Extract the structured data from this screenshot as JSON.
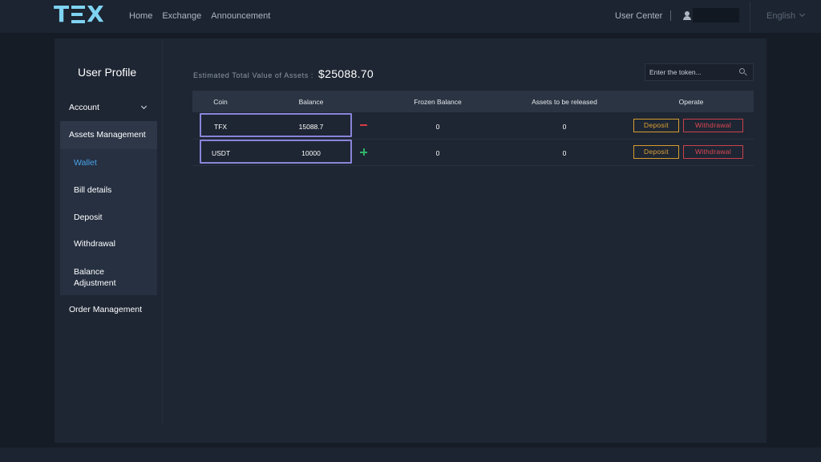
{
  "header": {
    "logo_text": "TEX",
    "nav": [
      "Home",
      "Exchange",
      "Announcement"
    ],
    "user_center": "User Center",
    "language": "English",
    "icons": [
      "user-icon",
      "chevron-down-icon"
    ]
  },
  "sidebar": {
    "title": "User Profile",
    "account": "Account",
    "assets_management": "Assets Management",
    "sub_items": [
      "Wallet",
      "Bill details",
      "Deposit",
      "Withdrawal",
      "Balance Adjustment"
    ],
    "active_item": "Wallet",
    "order_management": "Order Management"
  },
  "summary": {
    "label": "Estimated Total Value of Assets :",
    "value": "$25088.70"
  },
  "search": {
    "placeholder": "Enter the token..."
  },
  "table": {
    "columns": [
      "Coin",
      "Balance",
      "Frozen Balance",
      "Assets to be released",
      "Operate"
    ],
    "rows": [
      {
        "coin": "TFX",
        "balance": "15088.7",
        "frozen": "0",
        "to_release": "0",
        "adjust_icon": "minus-icon"
      },
      {
        "coin": "USDT",
        "balance": "10000",
        "frozen": "0",
        "to_release": "0",
        "adjust_icon": "plus-icon"
      }
    ],
    "deposit_label": "Deposit",
    "withdrawal_label": "Withdrawal"
  },
  "colors": {
    "accent_blue": "#4aa3e8",
    "highlight_box": "#8a84d9",
    "deposit": "#e0a236",
    "withdrawal": "#e04754",
    "minus": "#d73a45",
    "plus": "#2fb46a",
    "logo": "#7fd3f2"
  }
}
